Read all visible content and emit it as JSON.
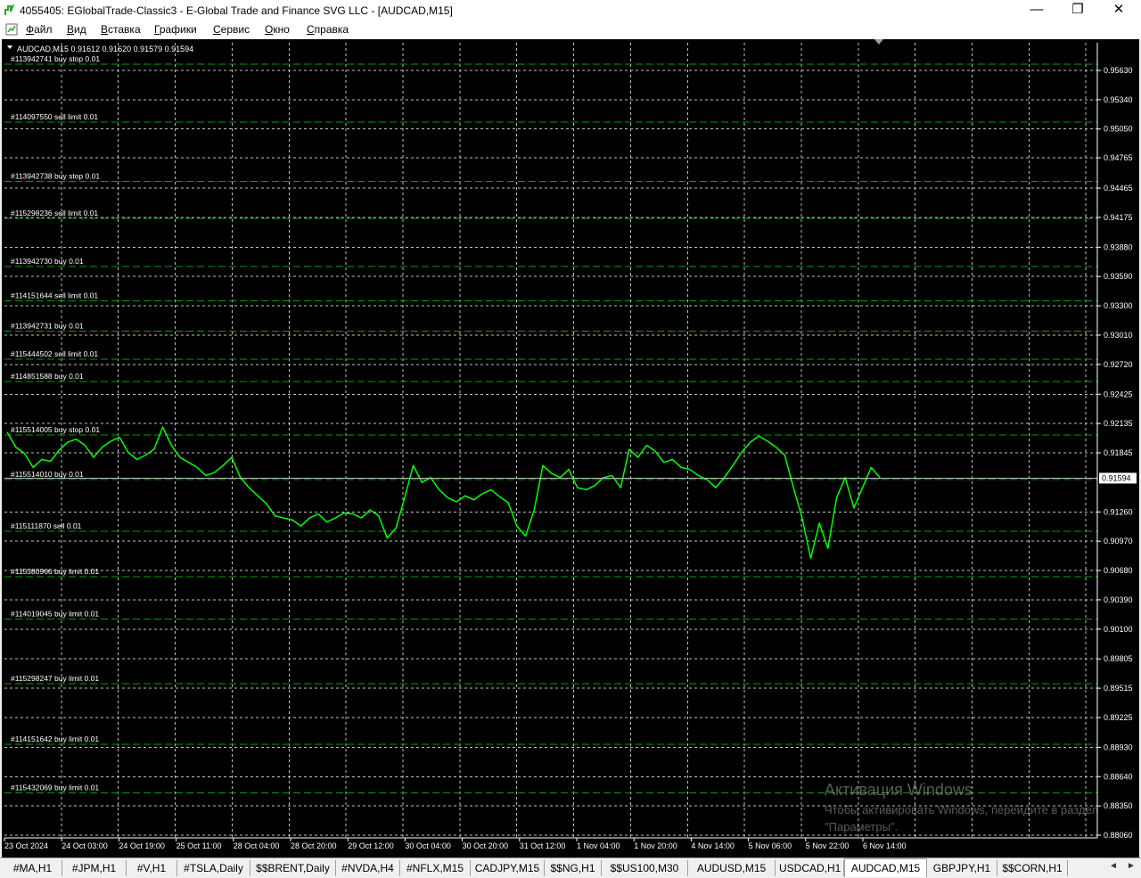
{
  "window": {
    "title": "4055405: EGlobalTrade-Classic3 - E-Global Trade and Finance SVG LLC - [AUDCAD,M15]",
    "minimize": "—",
    "maximize": "❐",
    "close": "✕"
  },
  "menu": [
    "Файл",
    "Вид",
    "Вставка",
    "Графики",
    "Сервис",
    "Окно",
    "Справка"
  ],
  "mdi": {
    "minimize": "–",
    "restore": "▫",
    "close": "✕"
  },
  "chart": {
    "header": "AUDCAD,M15  0.91612 0.91620 0.91579 0.91594",
    "symbol": "AUDCAD,M15",
    "current_price": "0.91594",
    "price_labels": [
      "0.95630",
      "0.95340",
      "0.95050",
      "0.94765",
      "0.94465",
      "0.94175",
      "0.93880",
      "0.93590",
      "0.93300",
      "0.93010",
      "0.92720",
      "0.92425",
      "0.92135",
      "0.91845",
      "0.91260",
      "0.90970",
      "0.90680",
      "0.90390",
      "0.90100",
      "0.89805",
      "0.89515",
      "0.89225",
      "0.88930",
      "0.88640",
      "0.88350",
      "0.88060"
    ],
    "time_labels": [
      "23 Oct 2024",
      "24 Oct 03:00",
      "24 Oct 19:00",
      "25 Oct 11:00",
      "28 Oct 04:00",
      "28 Oct 20:00",
      "29 Oct 12:00",
      "30 Oct 04:00",
      "30 Oct 20:00",
      "31 Oct 12:00",
      "1 Nov 04:00",
      "1 Nov 20:00",
      "4 Nov 14:00",
      "5 Nov 06:00",
      "5 Nov 22:00",
      "6 Nov 14:00"
    ],
    "orders": [
      {
        "label": "#113942741 buy stop 0.01",
        "price": 0.9569
      },
      {
        "label": "#114097550 sell limit 0.01",
        "price": 0.9512
      },
      {
        "label": "#113942738 buy stop 0.01",
        "price": 0.9453
      },
      {
        "label": "#115298236 sell limit 0.01",
        "price": 0.94165
      },
      {
        "label": "#113942730 buy 0.01",
        "price": 0.9369
      },
      {
        "label": "#114151644 sell limit 0.01",
        "price": 0.9335
      },
      {
        "label": "#113942731 buy 0.01",
        "price": 0.9305
      },
      {
        "label": "#115444502 sell limit 0.01",
        "price": 0.9277
      },
      {
        "label": "#114851588 buy 0.01",
        "price": 0.9255
      },
      {
        "label": "#115514005 buy stop 0.01",
        "price": 0.9202
      },
      {
        "label": "#115514010 buy 0.01",
        "price": 0.9158
      },
      {
        "label": "#115111870 sell 0.01",
        "price": 0.9107
      },
      {
        "label": "#115380966 buy limit 0.01",
        "price": 0.9062
      },
      {
        "label": "#114019045 buy limit 0.01",
        "price": 0.902
      },
      {
        "label": "#115298247 buy limit 0.01",
        "price": 0.8956
      },
      {
        "label": "#114151642 buy limit 0.01",
        "price": 0.8896
      },
      {
        "label": "#115432069 buy limit 0.01",
        "price": 0.8848
      }
    ],
    "colors": {
      "background": "#000000",
      "line": "#00ff00",
      "grid": "#c0c0c0",
      "order_line": "#00a000",
      "axis": "#ffffff"
    }
  },
  "chart_data": {
    "type": "line",
    "series": [
      {
        "values": [
          0.9205,
          0.919,
          0.9184,
          0.917,
          0.9178,
          0.9176,
          0.9187,
          0.9195,
          0.9198,
          0.9192,
          0.918,
          0.919,
          0.9196,
          0.92,
          0.9185,
          0.9178,
          0.9182,
          0.9188,
          0.921,
          0.9192,
          0.918,
          0.9175,
          0.917,
          0.9162,
          0.9165,
          0.9172,
          0.918,
          0.916,
          0.915,
          0.9142,
          0.9134,
          0.9122,
          0.912,
          0.9118,
          0.9112,
          0.912,
          0.9124,
          0.9116,
          0.912,
          0.9125,
          0.9124,
          0.912,
          0.9128,
          0.9122,
          0.91,
          0.911,
          0.914,
          0.9172,
          0.9155,
          0.916,
          0.9148,
          0.914,
          0.9136,
          0.9142,
          0.9138,
          0.9144,
          0.9148,
          0.9141,
          0.9135,
          0.9112,
          0.9102,
          0.9128,
          0.9172,
          0.9164,
          0.916,
          0.9168,
          0.915,
          0.9148,
          0.9152,
          0.916,
          0.9162,
          0.915,
          0.9188,
          0.918,
          0.9192,
          0.9186,
          0.9175,
          0.9178,
          0.917,
          0.9168,
          0.9162,
          0.9158,
          0.915,
          0.916,
          0.9172,
          0.9185,
          0.9195,
          0.9201,
          0.9196,
          0.919,
          0.9182,
          0.915,
          0.912,
          0.908,
          0.9115,
          0.909,
          0.914,
          0.916,
          0.913,
          0.915,
          0.917,
          0.916
        ]
      }
    ],
    "ylim": [
      0.8806,
      0.9563
    ],
    "x": [
      "23 Oct 2024",
      "24 Oct 03:00",
      "24 Oct 19:00",
      "25 Oct 11:00",
      "28 Oct 04:00",
      "28 Oct 20:00",
      "29 Oct 12:00",
      "30 Oct 04:00",
      "30 Oct 20:00",
      "31 Oct 12:00",
      "1 Nov 04:00",
      "1 Nov 20:00",
      "4 Nov 14:00",
      "5 Nov 06:00",
      "5 Nov 22:00",
      "6 Nov 14:00"
    ],
    "grid": true
  },
  "tabs": [
    "#MA,H1",
    "#JPM,H1",
    "#V,H1",
    "#TSLA,Daily",
    "$$BRENT,Daily",
    "#NVDA,H4",
    "#NFLX,M15",
    "CADJPY,M15",
    "$$NG,H1",
    "$$US100,M30",
    "AUDUSD,M15",
    "USDCAD,H1",
    "AUDCAD,M15",
    "GBPJPY,H1",
    "$$CORN,H1"
  ],
  "active_tab": "AUDCAD,M15",
  "tab_scroll": {
    "left": "◄",
    "right": "►"
  },
  "activation": {
    "title": "Активация Windows",
    "text": "Чтобы активировать Windows, перейдите в раздел \"Параметры\"."
  }
}
